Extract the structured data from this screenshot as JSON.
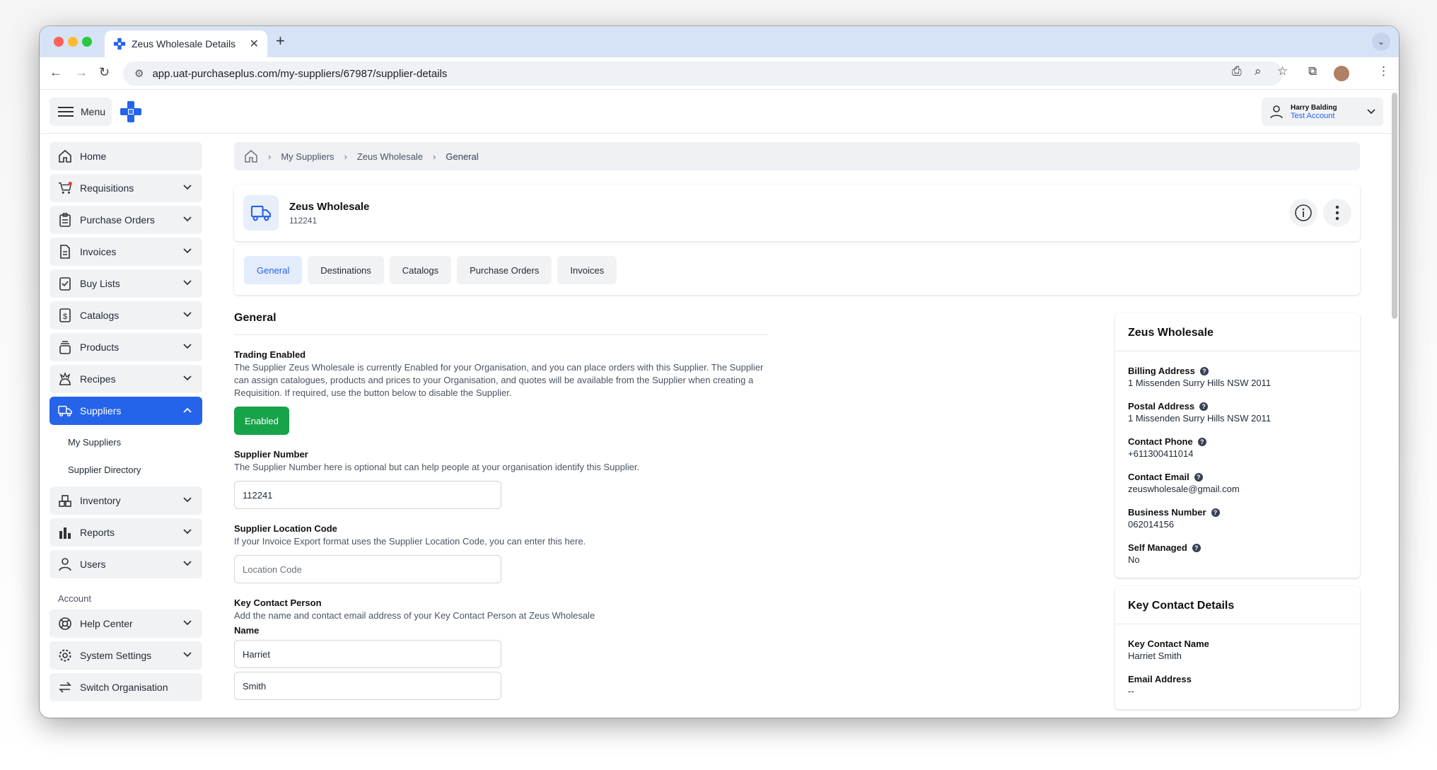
{
  "browser": {
    "tab_title": "Zeus Wholesale Details",
    "new_tab": "+",
    "url": "app.uat-purchaseplus.com/my-suppliers/67987/supplier-details"
  },
  "header": {
    "menu_label": "Menu",
    "user_name": "Harry Balding",
    "account_name": "Test Account"
  },
  "sidebar": {
    "items": [
      {
        "label": "Home",
        "icon": "home-icon"
      },
      {
        "label": "Requisitions",
        "icon": "cart-icon"
      },
      {
        "label": "Purchase Orders",
        "icon": "clipboard-icon"
      },
      {
        "label": "Invoices",
        "icon": "document-icon"
      },
      {
        "label": "Buy Lists",
        "icon": "checklist-icon"
      },
      {
        "label": "Catalogs",
        "icon": "dollar-doc-icon"
      },
      {
        "label": "Products",
        "icon": "stack-icon"
      },
      {
        "label": "Recipes",
        "icon": "chef-icon"
      },
      {
        "label": "Suppliers",
        "icon": "truck-icon"
      }
    ],
    "sub_items": [
      "My Suppliers",
      "Supplier Directory"
    ],
    "items2": [
      {
        "label": "Inventory",
        "icon": "boxes-icon"
      },
      {
        "label": "Reports",
        "icon": "bar-chart-icon"
      },
      {
        "label": "Users",
        "icon": "user-icon"
      }
    ],
    "account_label": "Account",
    "account_items": [
      {
        "label": "Help Center",
        "icon": "lifebuoy-icon"
      },
      {
        "label": "System Settings",
        "icon": "gear-icon"
      },
      {
        "label": "Switch Organisation",
        "icon": "switch-icon"
      }
    ]
  },
  "breadcrumb": [
    "My Suppliers",
    "Zeus Wholesale",
    "General"
  ],
  "supplier": {
    "name": "Zeus Wholesale",
    "number": "112241"
  },
  "tabs": [
    "General",
    "Destinations",
    "Catalogs",
    "Purchase Orders",
    "Invoices"
  ],
  "general": {
    "heading": "General",
    "trading_label": "Trading Enabled",
    "trading_desc": "The Supplier Zeus Wholesale is currently Enabled for your Organisation, and you can place orders with this Supplier. The Supplier can assign catalogues, products and prices to your Organisation, and quotes will be available from the Supplier when creating a Requisition. If required, use the button below to disable the Supplier.",
    "enabled_button": "Enabled",
    "supplier_number_label": "Supplier Number",
    "supplier_number_desc": "The Supplier Number here is optional but can help people at your organisation identify this Supplier.",
    "supplier_number_value": "112241",
    "location_label": "Supplier Location Code",
    "location_desc": "If your Invoice Export format uses the Supplier Location Code, you can enter this here.",
    "location_placeholder": "Location Code",
    "key_contact_label": "Key Contact Person",
    "key_contact_desc": "Add the name and contact email address of your Key Contact Person at Zeus Wholesale",
    "name_label": "Name",
    "first_name": "Harriet",
    "last_name": "Smith"
  },
  "info_card": {
    "title": "Zeus Wholesale",
    "fields": [
      {
        "label": "Billing Address",
        "value": "1 Missenden Surry Hills NSW 2011"
      },
      {
        "label": "Postal Address",
        "value": "1 Missenden Surry Hills NSW 2011"
      },
      {
        "label": "Contact Phone",
        "value": "+611300411014"
      },
      {
        "label": "Contact Email",
        "value": "zeuswholesale@gmail.com"
      },
      {
        "label": "Business Number",
        "value": "062014156"
      },
      {
        "label": "Self Managed",
        "value": "No"
      }
    ]
  },
  "contact_card": {
    "title": "Key Contact Details",
    "fields": [
      {
        "label": "Key Contact Name",
        "value": "Harriet Smith"
      },
      {
        "label": "Email Address",
        "value": "--"
      }
    ]
  },
  "colors": {
    "accent": "#2563eb",
    "success": "#16a34a",
    "tabstrip": "#d6e3f6"
  }
}
